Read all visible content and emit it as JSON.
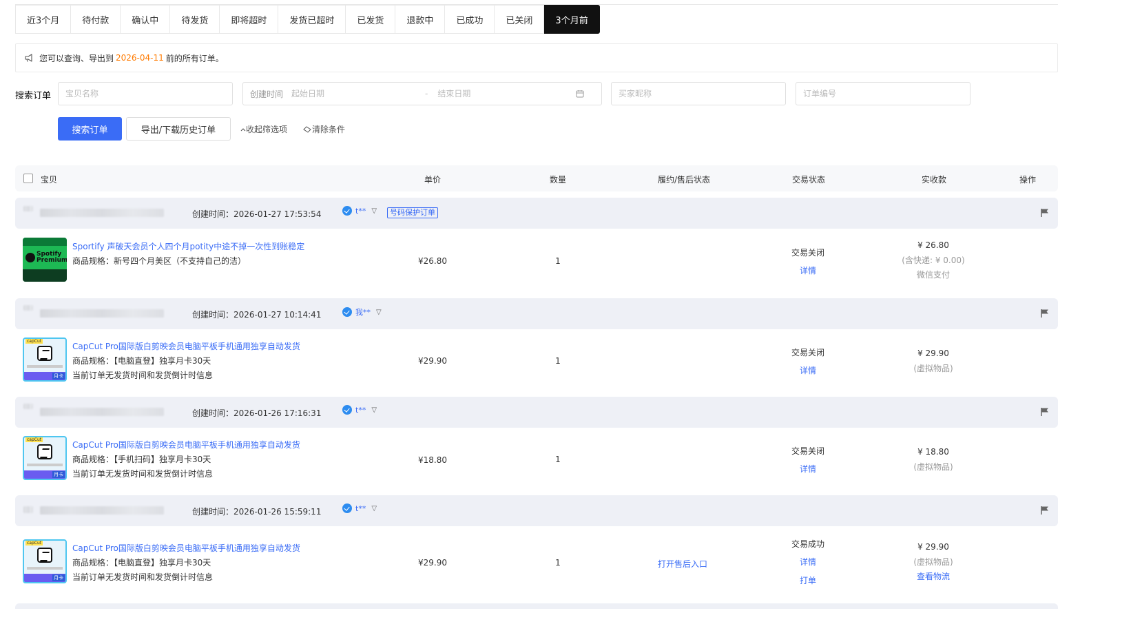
{
  "tabs": [
    "近3个月",
    "待付款",
    "确认中",
    "待发货",
    "即将超时",
    "发货已超时",
    "已发货",
    "退款中",
    "已成功",
    "已关闭",
    "3个月前"
  ],
  "active_tab": "3个月前",
  "notice": {
    "prefix": "您可以查询、导出到",
    "date": "2026-04-11",
    "suffix": "前的所有订单。"
  },
  "search": {
    "label": "搜索订单",
    "goods_placeholder": "宝贝名称",
    "date_label": "创建时间",
    "start_placeholder": "起始日期",
    "date_sep": "-",
    "end_placeholder": "结束日期",
    "buyer_placeholder": "买家昵称",
    "order_placeholder": "订单编号",
    "search_button": "搜索订单",
    "export_button": "导出/下载历史订单",
    "collapse_label": "收起筛选项",
    "clear_label": "清除条件"
  },
  "table_header": {
    "goods": "宝贝",
    "price": "单价",
    "qty": "数量",
    "fulfil": "履约/售后状态",
    "trade_status": "交易状态",
    "paid": "实收款",
    "ops": "操作"
  },
  "orders": [
    {
      "create_time": "创建时间：2026-01-27 17:53:54",
      "buyer": "t**",
      "protect_tag": "号码保护订单",
      "title": "Sportify 声破天会员个人四个月potity中途不掉一次性到账稳定",
      "spec": "商品规格：新号四个月美区（不支持自己的洁）",
      "note": "",
      "price": "¥26.80",
      "qty": "1",
      "fulfil": "",
      "status": "交易关闭",
      "detail": "详情",
      "print": "",
      "paid": "¥ 26.80",
      "paid_sub": "(含快递: ¥ 0.00)",
      "paid_sub2": "微信支付"
    },
    {
      "create_time": "创建时间：2026-01-27 10:14:41",
      "buyer": "我**",
      "protect_tag": "",
      "title": "CapCut Pro国际版白剪映会员电脑平板手机通用独享自动发货",
      "spec": "商品规格：【电脑直登】独享月卡30天",
      "note": "当前订单无发货时间和发货倒计时信息",
      "price": "¥29.90",
      "qty": "1",
      "fulfil": "",
      "status": "交易关闭",
      "detail": "详情",
      "print": "",
      "paid": "¥ 29.90",
      "paid_sub": "(虚拟物品)",
      "paid_sub2": ""
    },
    {
      "create_time": "创建时间：2026-01-26 17:16:31",
      "buyer": "t**",
      "protect_tag": "",
      "title": "CapCut Pro国际版白剪映会员电脑平板手机通用独享自动发货",
      "spec": "商品规格：【手机扫码】独享月卡30天",
      "note": "当前订单无发货时间和发货倒计时信息",
      "price": "¥18.80",
      "qty": "1",
      "fulfil": "",
      "status": "交易关闭",
      "detail": "详情",
      "print": "",
      "paid": "¥ 18.80",
      "paid_sub": "(虚拟物品)",
      "paid_sub2": ""
    },
    {
      "create_time": "创建时间：2026-01-26 15:59:11",
      "buyer": "t**",
      "protect_tag": "",
      "title": "CapCut Pro国际版白剪映会员电脑平板手机通用独享自动发货",
      "spec": "商品规格：【电脑直登】独享月卡30天",
      "note": "当前订单无发货时间和发货倒计时信息",
      "price": "¥29.90",
      "qty": "1",
      "fulfil": "打开售后入口",
      "status": "交易成功",
      "detail": "详情",
      "print": "打单",
      "paid": "¥ 29.90",
      "paid_sub": "(虚拟物品)",
      "paid_sub2": "查看物流"
    }
  ],
  "thumbs": {
    "spotify_word": "Spotify Premium",
    "capcut_brand": "capCut",
    "capcut_tag": "月卡"
  },
  "colors": {
    "accent": "#3a6cf6",
    "notice_date": "#ff7a00",
    "active_tab_bg": "#111111",
    "group_bg": "#eef0f6"
  }
}
